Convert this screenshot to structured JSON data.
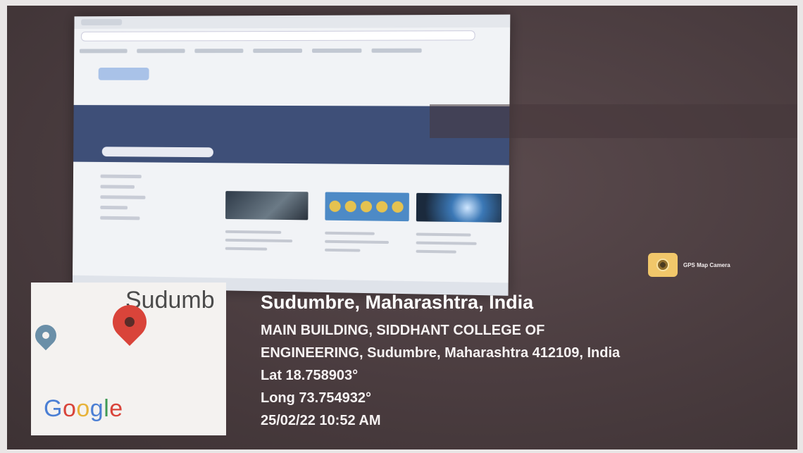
{
  "app": {
    "name": "GPS Map Camera"
  },
  "map": {
    "place_fragment": "Sudumb",
    "brand": [
      "G",
      "o",
      "o",
      "g",
      "l",
      "e"
    ]
  },
  "location": {
    "title": "Sudumbre, Maharashtra, India",
    "address_line1": "MAIN BUILDING, SIDDHANT COLLEGE OF",
    "address_line2": "ENGINEERING, Sudumbre, Maharashtra 412109, India",
    "lat": "Lat 18.758903°",
    "long": "Long 73.754932°",
    "timestamp": "25/02/22 10:52 AM"
  },
  "colors": {
    "background": "#4a3c3f",
    "pin": "#d9443a",
    "nav": "#3e4f78"
  }
}
